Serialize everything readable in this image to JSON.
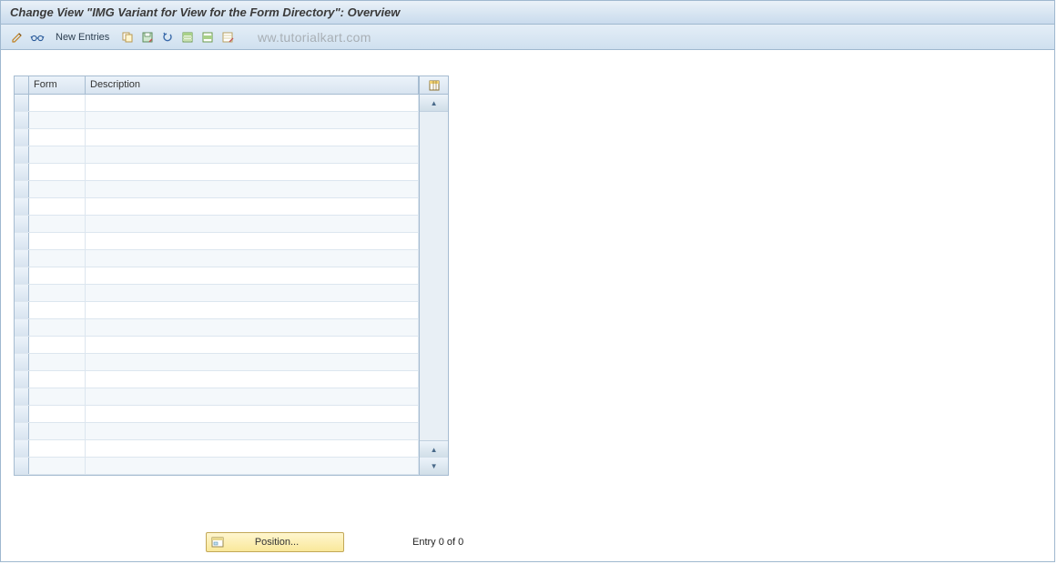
{
  "title": "Change View \"IMG Variant for View for the Form Directory\": Overview",
  "toolbar": {
    "new_entries_label": "New Entries"
  },
  "watermark": "ww.tutorialkart.com",
  "table": {
    "headers": {
      "form": "Form",
      "description": "Description"
    },
    "rows": [
      {
        "form": "",
        "description": ""
      },
      {
        "form": "",
        "description": ""
      },
      {
        "form": "",
        "description": ""
      },
      {
        "form": "",
        "description": ""
      },
      {
        "form": "",
        "description": ""
      },
      {
        "form": "",
        "description": ""
      },
      {
        "form": "",
        "description": ""
      },
      {
        "form": "",
        "description": ""
      },
      {
        "form": "",
        "description": ""
      },
      {
        "form": "",
        "description": ""
      },
      {
        "form": "",
        "description": ""
      },
      {
        "form": "",
        "description": ""
      },
      {
        "form": "",
        "description": ""
      },
      {
        "form": "",
        "description": ""
      },
      {
        "form": "",
        "description": ""
      },
      {
        "form": "",
        "description": ""
      },
      {
        "form": "",
        "description": ""
      },
      {
        "form": "",
        "description": ""
      },
      {
        "form": "",
        "description": ""
      },
      {
        "form": "",
        "description": ""
      },
      {
        "form": "",
        "description": ""
      },
      {
        "form": "",
        "description": ""
      }
    ]
  },
  "footer": {
    "position_label": "Position...",
    "entry_status": "Entry 0 of 0"
  },
  "icons": {
    "pencil": "pencil-icon",
    "glasses": "glasses-icon",
    "copy": "copy-icon",
    "save_var": "save-variant-icon",
    "undo": "undo-icon",
    "select_all": "select-all-icon",
    "select_block": "select-block-icon",
    "deselect": "deselect-icon",
    "config": "table-config-icon",
    "position": "position-icon"
  }
}
